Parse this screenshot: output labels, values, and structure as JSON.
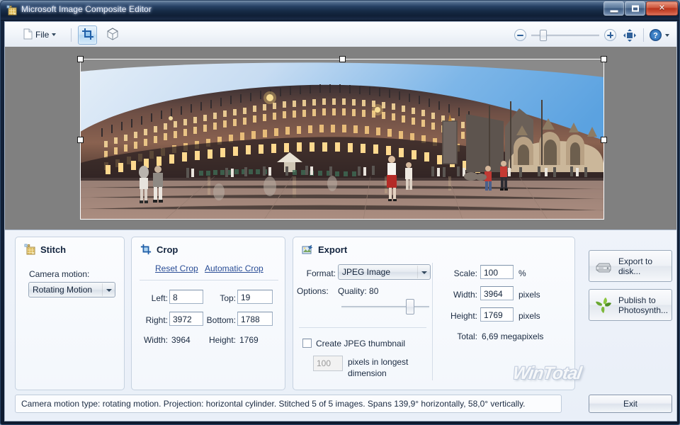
{
  "window": {
    "title": "Microsoft Image Composite Editor",
    "icon": "app-mosaic-icon",
    "minimize_label": "Minimize",
    "maximize_label": "Maximize",
    "close_label": "Close"
  },
  "toolbar": {
    "file_label": "File",
    "file_icon": "document-icon",
    "crop_tool_icon": "crop-icon",
    "view3d_tool_icon": "cube-3d-icon",
    "zoom_out_icon": "zoom-out-icon",
    "zoom_in_icon": "zoom-in-icon",
    "fit_icon": "fit-to-window-icon",
    "help_icon": "help-question-icon",
    "zoom_value": 12
  },
  "canvas": {
    "background_color": "#808080",
    "selection_color": "#ffffff",
    "image_description": "Panorama of Piazza San Marco, Venice at dusk"
  },
  "stitch": {
    "title": "Stitch",
    "icon": "stitch-grid-icon",
    "camera_motion_label": "Camera motion:",
    "camera_motion_value": "Rotating Motion"
  },
  "crop": {
    "title": "Crop",
    "icon": "crop-icon",
    "reset_link": "Reset Crop",
    "automatic_link": "Automatic Crop",
    "left_label": "Left:",
    "left_value": "8",
    "top_label": "Top:",
    "top_value": "19",
    "right_label": "Right:",
    "right_value": "3972",
    "bottom_label": "Bottom:",
    "bottom_value": "1788",
    "width_label": "Width:",
    "width_value": "3964",
    "height_label": "Height:",
    "height_value": "1769"
  },
  "export": {
    "title": "Export",
    "icon": "export-image-icon",
    "format_label": "Format:",
    "format_value": "JPEG Image",
    "options_label": "Options:",
    "quality_label": "Quality: 80",
    "quality_value": 80,
    "thumbnail_checkbox_label": "Create JPEG thumbnail",
    "thumbnail_checked": false,
    "thumbnail_size_value": "100",
    "thumbnail_size_label": "pixels in longest\ndimension",
    "scale_label": "Scale:",
    "scale_value": "100",
    "scale_unit": "%",
    "width_label": "Width:",
    "width_value": "3964",
    "width_unit": "pixels",
    "height_label": "Height:",
    "height_value": "1769",
    "height_unit": "pixels",
    "total_label": "Total:",
    "total_value": "6,69 megapixels"
  },
  "actions": {
    "export_to_disk": "Export to\ndisk...",
    "export_to_disk_icon": "hard-disk-icon",
    "publish_to_photosynth": "Publish to\nPhotosynth...",
    "publish_icon": "photosynth-leaf-icon"
  },
  "status": {
    "text": "Camera motion type: rotating motion. Projection: horizontal cylinder. Stitched 5 of 5 images. Spans 139,9° horizontally, 58,0° vertically.",
    "exit_label": "Exit"
  },
  "watermark": {
    "text": "WinTotal"
  }
}
